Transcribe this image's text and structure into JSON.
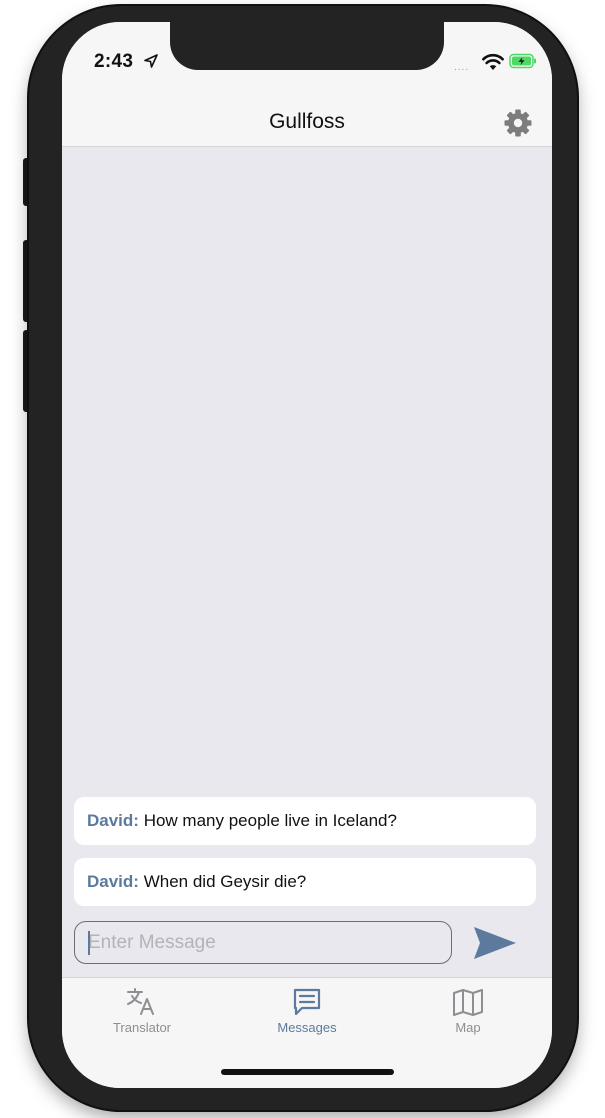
{
  "status_bar": {
    "time": "2:43",
    "signal": "....",
    "location_icon": "location-arrow-icon",
    "wifi_icon": "wifi-icon",
    "battery_icon": "battery-charging-icon"
  },
  "header": {
    "title": "Gullfoss",
    "settings_icon": "gear-icon"
  },
  "messages": [
    {
      "sender": "David:",
      "text": "How many people live in Iceland?"
    },
    {
      "sender": "David:",
      "text": "When did Geysir die?"
    }
  ],
  "composer": {
    "value": "",
    "placeholder": "Enter Message",
    "send_icon": "send-icon"
  },
  "tabs": [
    {
      "label": "Translator",
      "icon": "translate-icon",
      "active": false
    },
    {
      "label": "Messages",
      "icon": "message-icon",
      "active": true
    },
    {
      "label": "Map",
      "icon": "map-icon",
      "active": false
    }
  ],
  "colors": {
    "accent": "#5b7a9e",
    "chat_background": "#e8e8ee",
    "bar_background": "#f6f6f6",
    "inactive": "#8e8e93"
  }
}
